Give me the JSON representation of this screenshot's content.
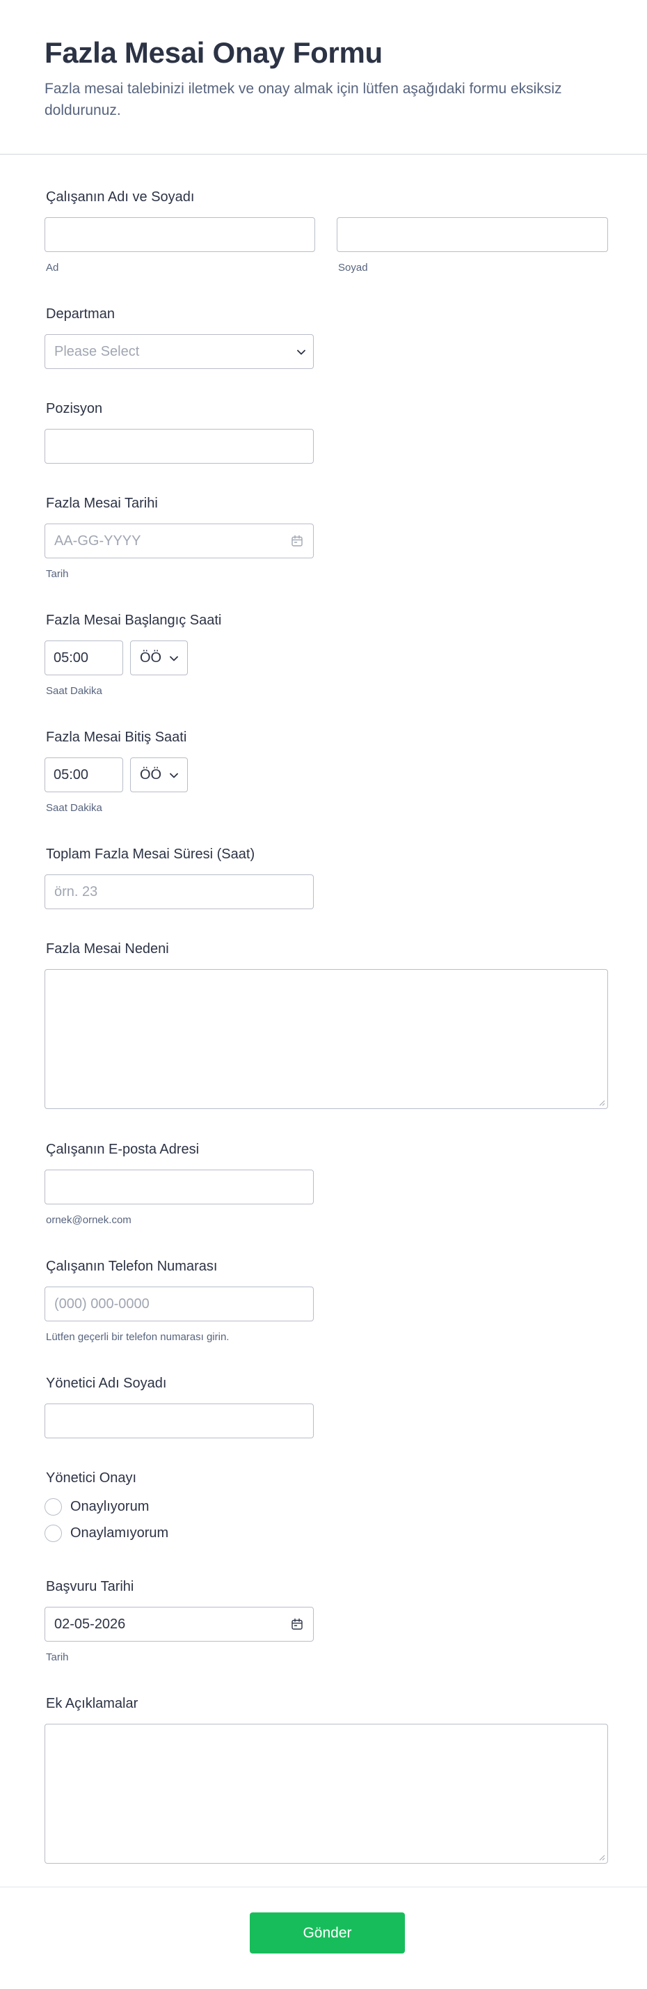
{
  "header": {
    "title": "Fazla Mesai Onay Formu",
    "description": "Fazla mesai talebinizi iletmek ve onay almak için lütfen aşağıdaki formu eksiksiz doldurunuz."
  },
  "fields": {
    "employee_name": {
      "label": "Çalışanın Adı ve Soyadı",
      "first_value": "",
      "last_value": "",
      "first_sublabel": "Ad",
      "last_sublabel": "Soyad"
    },
    "department": {
      "label": "Departman",
      "placeholder": "Please Select"
    },
    "position": {
      "label": "Pozisyon",
      "value": ""
    },
    "overtime_date": {
      "label": "Fazla Mesai Tarihi",
      "placeholder": "AA-GG-YYYY",
      "sublabel": "Tarih"
    },
    "start_time": {
      "label": "Fazla Mesai Başlangıç Saati",
      "time_value": "05:00",
      "ampm_value": "ÖÖ",
      "sublabel": "Saat Dakika"
    },
    "end_time": {
      "label": "Fazla Mesai Bitiş Saati",
      "time_value": "05:00",
      "ampm_value": "ÖÖ",
      "sublabel": "Saat Dakika"
    },
    "total_hours": {
      "label": "Toplam Fazla Mesai Süresi (Saat)",
      "placeholder": "örn. 23"
    },
    "reason": {
      "label": "Fazla Mesai Nedeni",
      "value": ""
    },
    "email": {
      "label": "Çalışanın E-posta Adresi",
      "value": "",
      "sublabel": "ornek@ornek.com"
    },
    "phone": {
      "label": "Çalışanın Telefon Numarası",
      "placeholder": "(000) 000-0000",
      "sublabel": "Lütfen geçerli bir telefon numarası girin."
    },
    "manager_name": {
      "label": "Yönetici Adı Soyadı",
      "value": ""
    },
    "manager_approval": {
      "label": "Yönetici Onayı",
      "options": [
        "Onaylıyorum",
        "Onaylamıyorum"
      ]
    },
    "application_date": {
      "label": "Başvuru Tarihi",
      "value": "02-05-2026",
      "sublabel": "Tarih"
    },
    "notes": {
      "label": "Ek Açıklamalar",
      "value": ""
    }
  },
  "submit": {
    "label": "Gönder"
  },
  "colors": {
    "accent": "#18bd5b",
    "text": "#2c3345",
    "subtext": "#57647e",
    "border": "#b8bdc9",
    "placeholder": "#a0a6b2"
  },
  "icons": {
    "select": "chevron-down-icon",
    "date": "calendar-icon",
    "resize": "resize-grip-icon"
  }
}
